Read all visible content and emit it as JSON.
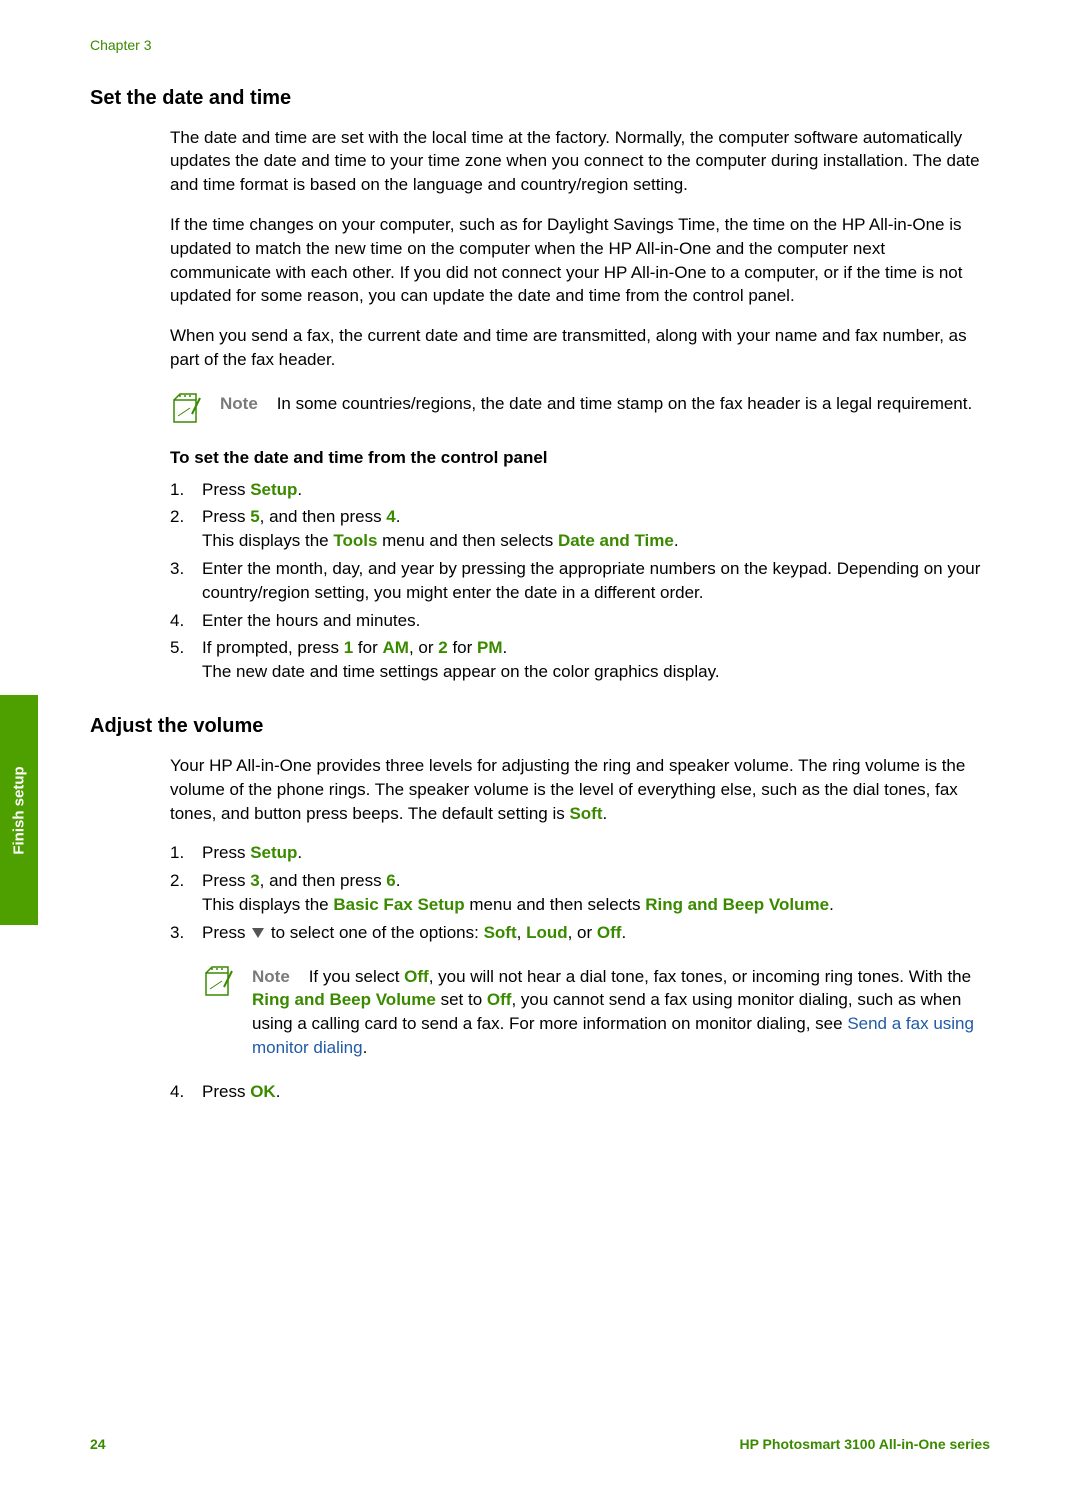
{
  "chapter": "Chapter 3",
  "sideTab": "Finish setup",
  "section1": {
    "title": "Set the date and time",
    "p1": "The date and time are set with the local time at the factory. Normally, the computer software automatically updates the date and time to your time zone when you connect to the computer during installation. The date and time format is based on the language and country/region setting.",
    "p2": "If the time changes on your computer, such as for Daylight Savings Time, the time on the HP All-in-One is updated to match the new time on the computer when the HP All-in-One and the computer next communicate with each other. If you did not connect your HP All-in-One to a computer, or if the time is not updated for some reason, you can update the date and time from the control panel.",
    "p3": "When you send a fax, the current date and time are transmitted, along with your name and fax number, as part of the fax header.",
    "noteLabel": "Note",
    "noteText": "In some countries/regions, the date and time stamp on the fax header is a legal requirement.",
    "procTitle": "To set the date and time from the control panel",
    "steps": {
      "s1": {
        "num": "1.",
        "a": "Press ",
        "kw1": "Setup",
        "b": "."
      },
      "s2": {
        "num": "2.",
        "a": "Press ",
        "kw1": "5",
        "b": ", and then press ",
        "kw2": "4",
        "c": ".",
        "line2a": "This displays the ",
        "line2kw1": "Tools",
        "line2b": " menu and then selects ",
        "line2kw2": "Date and Time",
        "line2c": "."
      },
      "s3": {
        "num": "3.",
        "t": "Enter the month, day, and year by pressing the appropriate numbers on the keypad. Depending on your country/region setting, you might enter the date in a different order."
      },
      "s4": {
        "num": "4.",
        "t": "Enter the hours and minutes."
      },
      "s5": {
        "num": "5.",
        "a": "If prompted, press ",
        "kw1": "1",
        "b": " for ",
        "kw2": "AM",
        "c": ", or ",
        "kw3": "2",
        "d": " for ",
        "kw4": "PM",
        "e": ".",
        "line2": "The new date and time settings appear on the color graphics display."
      }
    }
  },
  "section2": {
    "title": "Adjust the volume",
    "p1a": "Your HP All-in-One provides three levels for adjusting the ring and speaker volume. The ring volume is the volume of the phone rings. The speaker volume is the level of everything else, such as the dial tones, fax tones, and button press beeps. The default setting is ",
    "p1kw": "Soft",
    "p1b": ".",
    "steps": {
      "s1": {
        "num": "1.",
        "a": "Press ",
        "kw1": "Setup",
        "b": "."
      },
      "s2": {
        "num": "2.",
        "a": "Press ",
        "kw1": "3",
        "b": ", and then press ",
        "kw2": "6",
        "c": ".",
        "line2a": "This displays the ",
        "line2kw1": "Basic Fax Setup",
        "line2b": " menu and then selects ",
        "line2kw2": "Ring and Beep Volume",
        "line2c": "."
      },
      "s3": {
        "num": "3.",
        "a": "Press ",
        "b": " to select one of the options: ",
        "kw1": "Soft",
        "c": ", ",
        "kw2": "Loud",
        "d": ", or ",
        "kw3": "Off",
        "e": "."
      },
      "noteLabel": "Note",
      "note": {
        "a": "If you select ",
        "kw1": "Off",
        "b": ", you will not hear a dial tone, fax tones, or incoming ring tones. With the ",
        "kw2": "Ring and Beep Volume",
        "c": " set to ",
        "kw3": "Off",
        "d": ", you cannot send a fax using monitor dialing, such as when using a calling card to send a fax. For more information on monitor dialing, see ",
        "link": "Send a fax using monitor dialing",
        "e": "."
      },
      "s4": {
        "num": "4.",
        "a": "Press ",
        "kw1": "OK",
        "b": "."
      }
    }
  },
  "footer": {
    "page": "24",
    "product": "HP Photosmart 3100 All-in-One series"
  }
}
